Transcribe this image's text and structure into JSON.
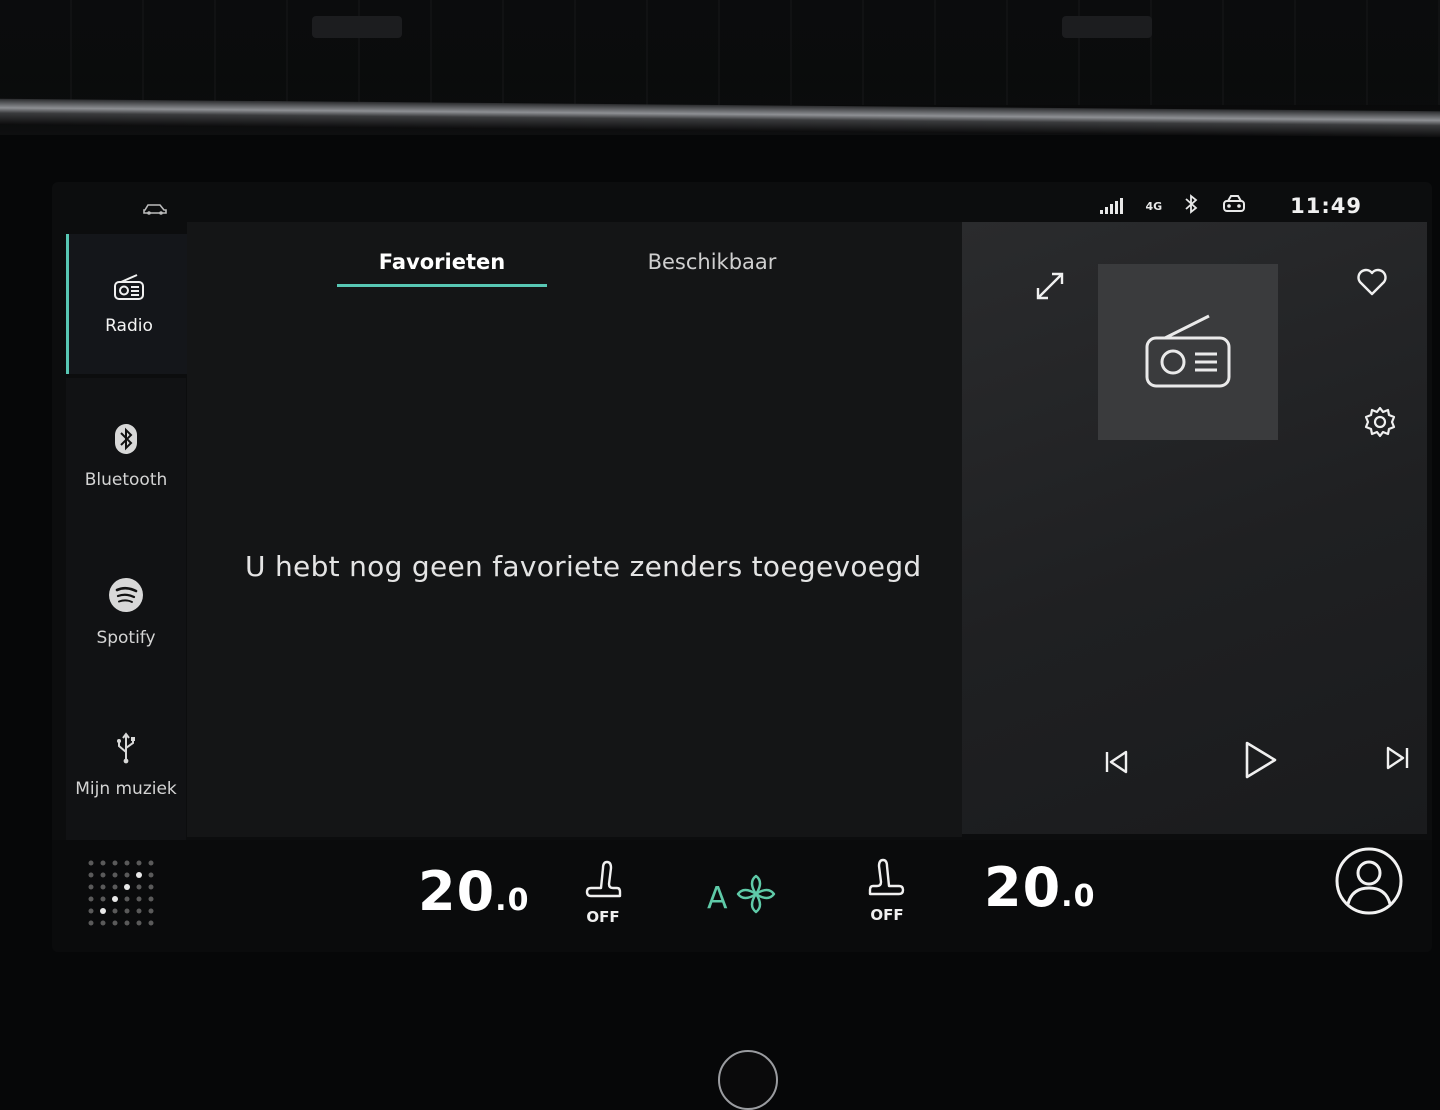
{
  "status": {
    "network": "4G",
    "time": "11:49"
  },
  "sidebar": {
    "items": [
      {
        "label": "Radio",
        "icon": "radio-icon"
      },
      {
        "label": "Bluetooth",
        "icon": "bluetooth-icon"
      },
      {
        "label": "Spotify",
        "icon": "spotify-icon"
      },
      {
        "label": "Mijn muziek",
        "icon": "usb-icon"
      }
    ]
  },
  "tabs": [
    {
      "label": "Favorieten"
    },
    {
      "label": "Beschikbaar"
    }
  ],
  "main": {
    "empty_message": "U hebt nog geen favoriete zenders toegevoegd"
  },
  "player": {
    "icons": [
      "expand-icon",
      "radio-icon",
      "heart-icon",
      "gear-icon",
      "previous-icon",
      "play-icon",
      "next-icon"
    ]
  },
  "climate": {
    "left_temp": "20",
    "left_temp_decimal": "0",
    "left_seat_label": "OFF",
    "fan_mode": "A",
    "right_seat_label": "OFF",
    "right_temp": "20",
    "right_temp_decimal": "0"
  },
  "colors": {
    "accent": "#58c7b4",
    "fan": "#5fcaa8"
  }
}
